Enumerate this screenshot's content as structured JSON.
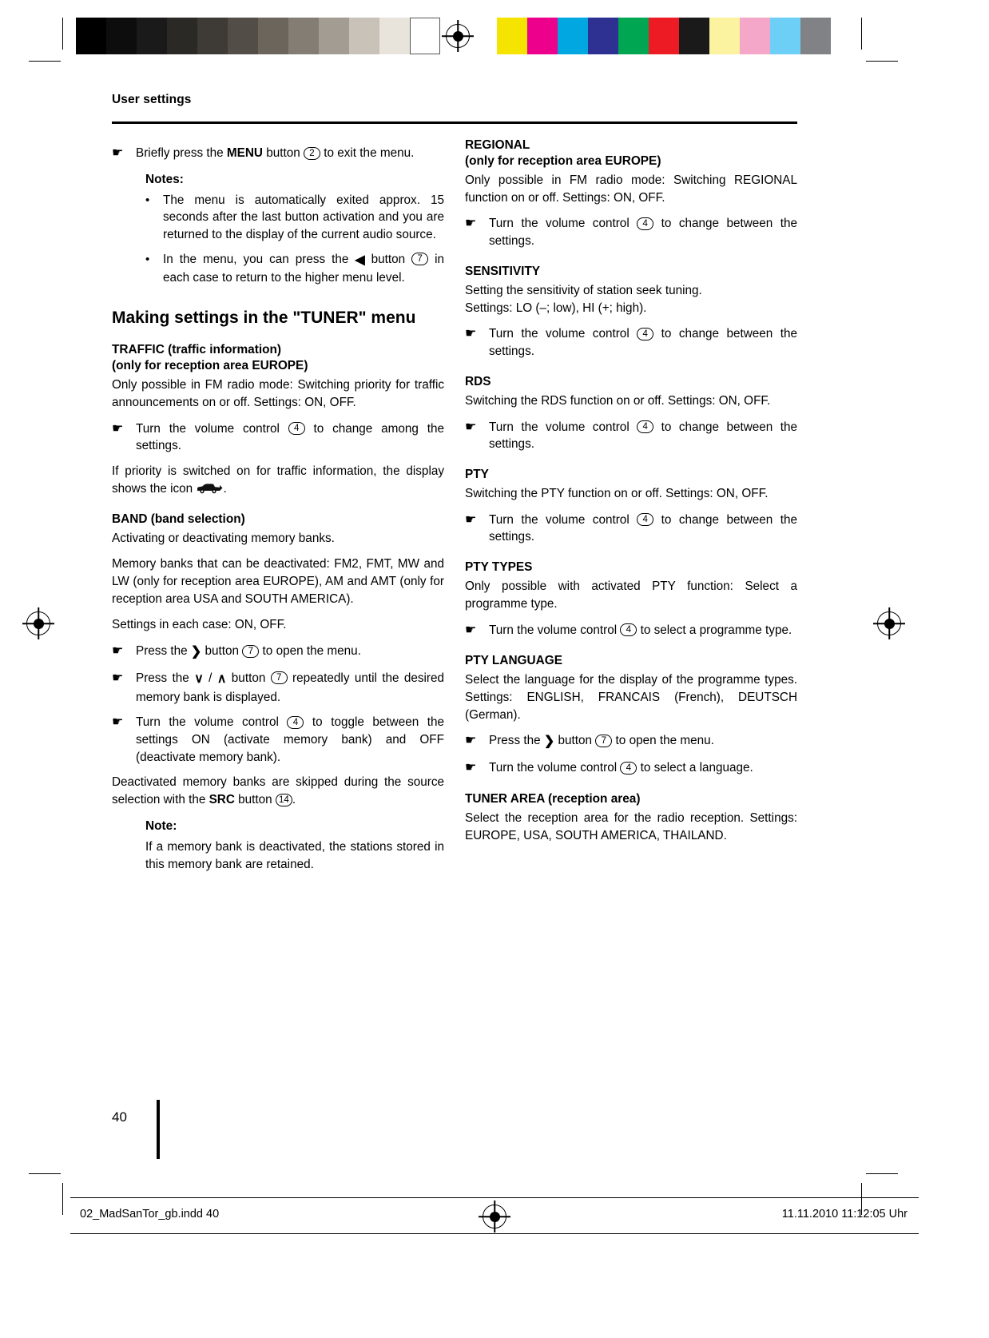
{
  "printmarks": {
    "grayscale_swatches": [
      "#000000",
      "#0d0d0d",
      "#1a1a1a",
      "#2b2926",
      "#3e3a35",
      "#524d46",
      "#6b655c",
      "#847d73",
      "#a39c92",
      "#c8c2b8",
      "#e8e4dc",
      "#ffffff"
    ],
    "color_swatches": [
      "#f5e400",
      "#ec008c",
      "#00a7e1",
      "#2e3192",
      "#00a651",
      "#ed1c24",
      "#1a1a1a",
      "#fbf3a0",
      "#f4a7c8",
      "#6dcff6",
      "#808285"
    ],
    "registration_icon": "registration-target-icon"
  },
  "header": {
    "running_head": "User settings"
  },
  "left_column": {
    "intro": {
      "hand_icon": "pointing-hand-icon",
      "text_before": "Briefly press the ",
      "bold": "MENU",
      "text_mid": " button ",
      "callout": "2",
      "text_after": " to exit the menu."
    },
    "notes_title": "Notes:",
    "notes": [
      "The menu is automatically exited approx. 15 seconds after the last button activation and you are returned to the display of the current audio source.",
      {
        "text_before": "In the menu, you can press the ",
        "glyph": "◀",
        "text_mid": " button ",
        "callout": "7",
        "text_after": " in each case to return to the higher menu level."
      }
    ],
    "section_title": "Making settings in the \"TUNER\" menu",
    "traffic": {
      "heading_line1": "TRAFFIC (traffic information)",
      "heading_line2": "(only for reception area EUROPE)",
      "body": "Only possible in FM radio mode: Switching priority for traffic announcements on or off. Settings: ON, OFF.",
      "step": {
        "text_before": "Turn the volume control ",
        "callout": "4",
        "text_after": " to change among the settings."
      },
      "note": {
        "text_before": "If priority is switched on for traffic information, the display shows the icon ",
        "icon": "traffic-car-icon",
        "text_after": "."
      }
    },
    "band": {
      "heading": "BAND (band selection)",
      "body1": "Activating or deactivating memory banks.",
      "body2": "Memory banks that can be deactivated: FM2, FMT, MW and LW (only for reception area EUROPE), AM and AMT (only for reception area USA and SOUTH AMERICA).",
      "body3": "Settings in each case: ON, OFF.",
      "steps": [
        {
          "text_before": "Press the ",
          "glyph": "❯",
          "text_mid": " button ",
          "callout": "7",
          "text_after": " to open the menu."
        },
        {
          "text_before": "Press the ",
          "glyph": "∨",
          "glyph_sep": " / ",
          "glyph2": "∧",
          "text_mid": " button ",
          "callout": "7",
          "text_after": " repeatedly until the desired memory bank is displayed."
        },
        {
          "text_before": "Turn the volume control ",
          "callout": "4",
          "text_after": " to toggle between the settings ON (activate memory bank) and OFF (deactivate memory bank)."
        }
      ],
      "body4_before": "Deactivated memory banks are skipped during the source selection with the ",
      "body4_bold": "SRC",
      "body4_mid": " button ",
      "body4_callout": "14",
      "body4_after": ".",
      "note_title": "Note:",
      "note_text": "If a memory bank is deactivated, the stations stored in this memory bank are retained."
    }
  },
  "right_column": {
    "regional": {
      "heading_line1": "REGIONAL",
      "heading_line2": "(only for reception area EUROPE)",
      "body": "Only possible in FM radio mode: Switching REGIONAL function on or off. Settings: ON, OFF.",
      "step": {
        "text_before": "Turn the volume control ",
        "callout": "4",
        "text_after": " to change between the settings."
      }
    },
    "sensitivity": {
      "heading": "SENSITIVITY",
      "body_line1": "Setting the sensitivity of station seek tuning.",
      "body_line2": "Settings: LO (–; low), HI (+; high).",
      "step": {
        "text_before": "Turn the volume control ",
        "callout": "4",
        "text_after": " to change between the settings."
      }
    },
    "rds": {
      "heading": "RDS",
      "body": "Switching the RDS function on or off. Settings: ON, OFF.",
      "step": {
        "text_before": "Turn the volume control ",
        "callout": "4",
        "text_after": " to change between the settings."
      }
    },
    "pty": {
      "heading": "PTY",
      "body": "Switching the PTY function on or off. Settings: ON, OFF.",
      "step": {
        "text_before": "Turn the volume control ",
        "callout": "4",
        "text_after": " to change between the settings."
      }
    },
    "pty_types": {
      "heading": "PTY TYPES",
      "body": "Only possible with activated PTY function: Select a programme type.",
      "step": {
        "text_before": "Turn the volume control ",
        "callout": "4",
        "text_after": " to select a programme type."
      }
    },
    "pty_language": {
      "heading": "PTY LANGUAGE",
      "body": "Select the language for the display of the programme types. Settings: ENGLISH, FRANCAIS (French), DEUTSCH (German).",
      "steps": [
        {
          "text_before": "Press the ",
          "glyph": "❯",
          "text_mid": " button ",
          "callout": "7",
          "text_after": " to open the menu."
        },
        {
          "text_before": "Turn the volume control ",
          "callout": "4",
          "text_after": " to select a language."
        }
      ]
    },
    "tuner_area": {
      "heading": "TUNER AREA (reception area)",
      "body": "Select the reception area for the radio reception. Settings: EUROPE, USA, SOUTH AMERICA, THAILAND."
    }
  },
  "folio": {
    "page_number": "40"
  },
  "footer": {
    "file_name": "02_MadSanTor_gb.indd   40",
    "timestamp": "11.11.2010   11:12:05 Uhr",
    "registration_icon": "registration-target-icon"
  }
}
